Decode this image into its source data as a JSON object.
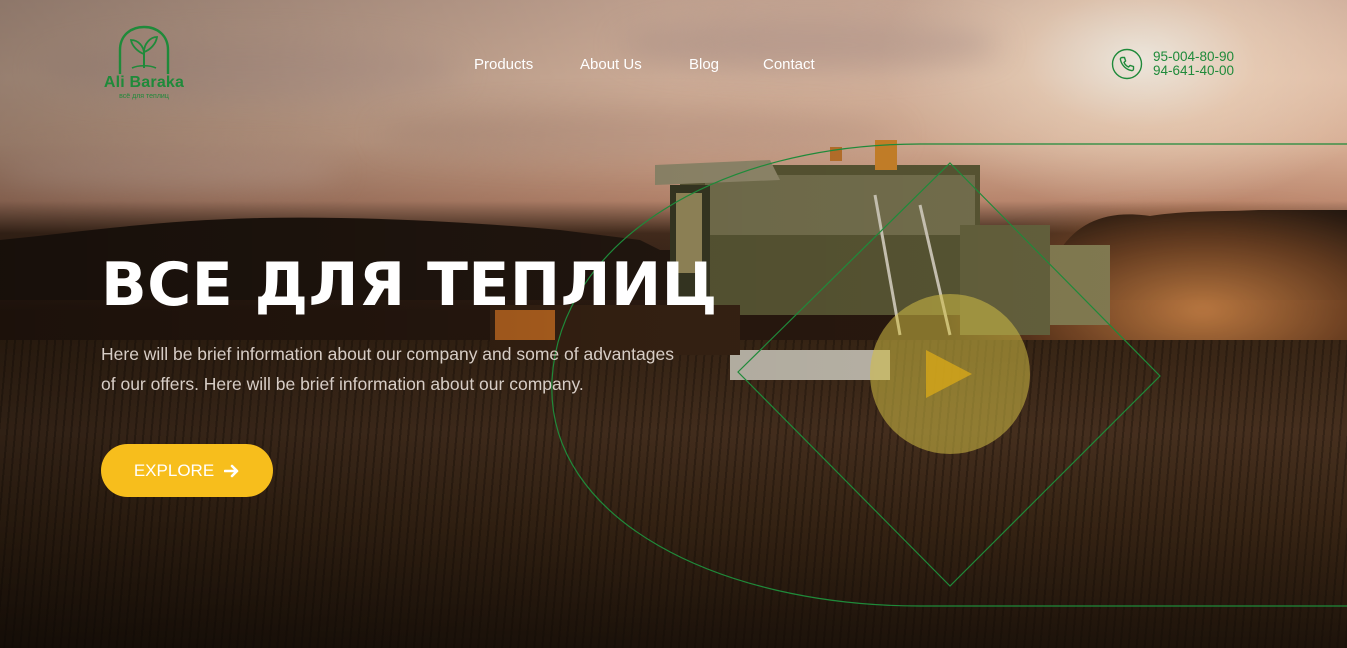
{
  "brand": {
    "name": "Ali Baraka",
    "tagline": "всё для теплиц",
    "color": "#1f8a3a"
  },
  "nav": {
    "items": [
      "Products",
      "About Us",
      "Blog",
      "Contact"
    ]
  },
  "contact": {
    "phones": [
      "95-004-80-90",
      "94-641-40-00"
    ],
    "icon": "phone-icon"
  },
  "hero": {
    "title": "ВСЕ ДЛЯ ТЕПЛИЦ",
    "description": "Here will be brief information about our company and some of advantages of our offers. Here will be brief information about our company.",
    "cta_label": "EXPLORE",
    "cta_icon": "arrow-right-icon",
    "cta_color": "#f7be1c",
    "play_icon": "play-icon"
  }
}
